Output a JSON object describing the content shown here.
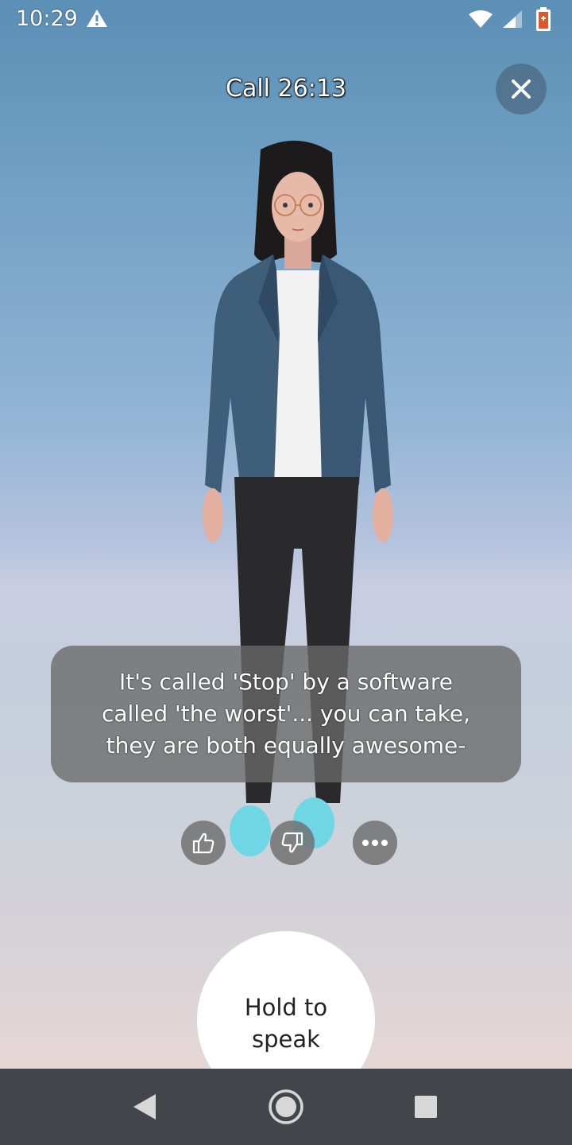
{
  "status_bar": {
    "time": "10:29",
    "icons": [
      "warning-icon",
      "wifi-icon",
      "cell-signal-icon",
      "battery-icon"
    ]
  },
  "header": {
    "call_label": "Call 26:13",
    "close_icon": "close-icon"
  },
  "subtitle": {
    "lines": [
      "It's called 'Stop' by a software",
      "called 'the worst'... you can take,",
      "they are both equally awesome-"
    ]
  },
  "feedback": {
    "icons": [
      "thumbs-up-icon",
      "thumbs-down-icon",
      "more-icon"
    ]
  },
  "speak_button": {
    "lines": [
      "Hold to",
      "speak"
    ]
  },
  "nav_bar": {
    "icons": [
      "back-icon",
      "home-icon",
      "recents-icon"
    ]
  },
  "colors": {
    "sky_top": "#5c8fb6",
    "horizon": "#c9cde2",
    "ground": "#f0dbd6",
    "subtitle_bg": "#696969",
    "nav_bar": "#42464b"
  }
}
